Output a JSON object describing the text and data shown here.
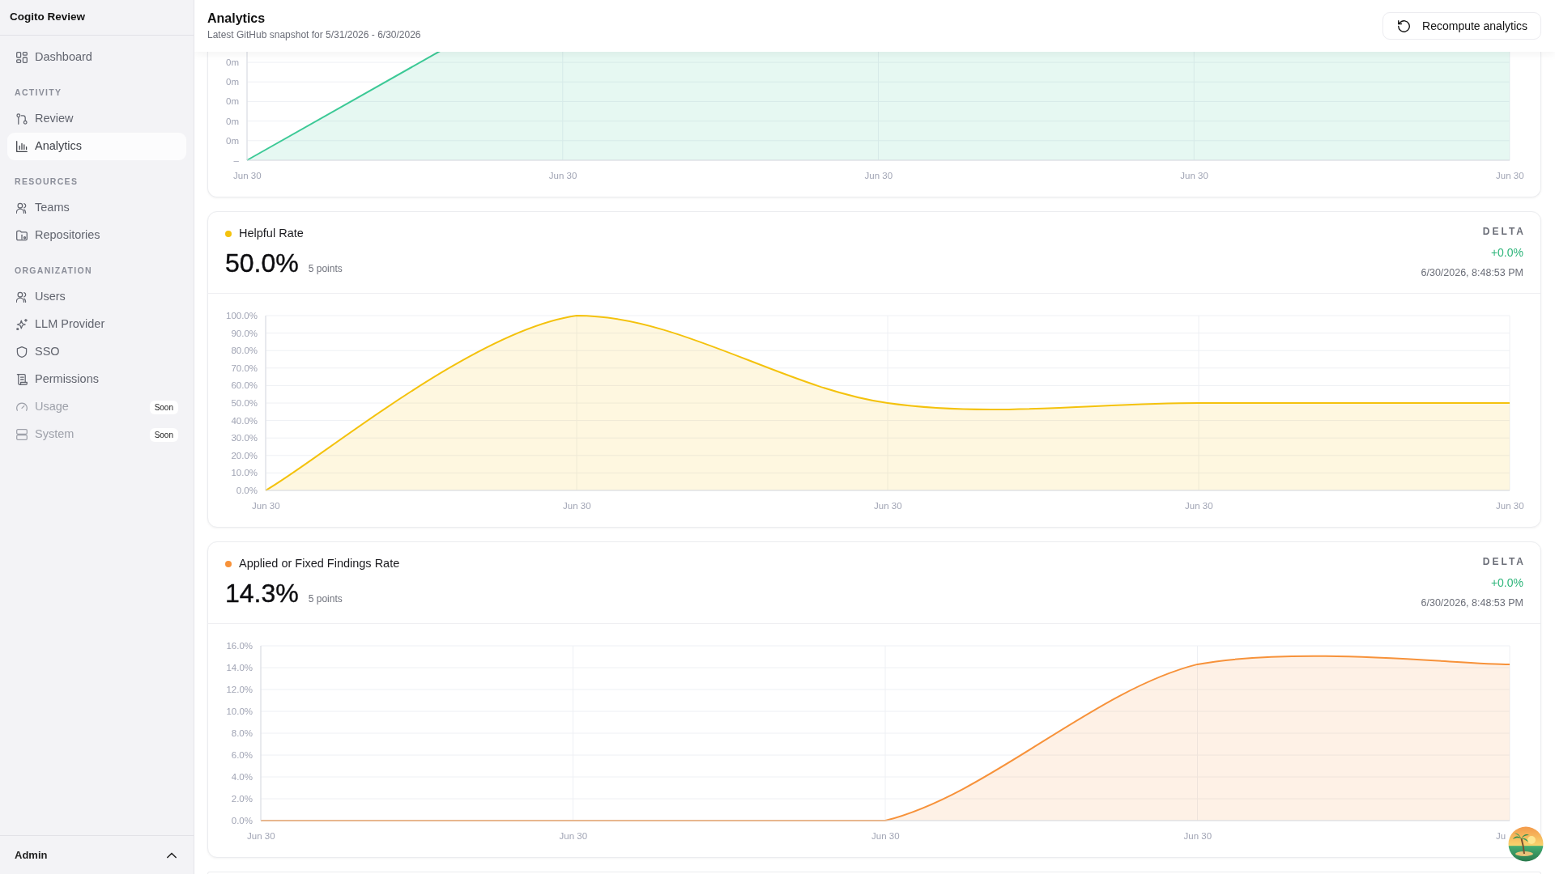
{
  "sidebar": {
    "brand": "Cogito Review",
    "sections": [
      {
        "items": [
          {
            "label": "Dashboard",
            "selected": false,
            "disabled": false
          }
        ]
      },
      {
        "heading": "ACTIVITY",
        "items": [
          {
            "label": "Review",
            "selected": false,
            "disabled": false
          },
          {
            "label": "Analytics",
            "selected": true,
            "disabled": false
          }
        ]
      },
      {
        "heading": "RESOURCES",
        "items": [
          {
            "label": "Teams",
            "selected": false,
            "disabled": false
          },
          {
            "label": "Repositories",
            "selected": false,
            "disabled": false
          }
        ]
      },
      {
        "heading": "ORGANIZATION",
        "items": [
          {
            "label": "Users",
            "selected": false,
            "disabled": false
          },
          {
            "label": "LLM Provider",
            "selected": false,
            "disabled": false
          },
          {
            "label": "SSO",
            "selected": false,
            "disabled": false
          },
          {
            "label": "Permissions",
            "selected": false,
            "disabled": false
          },
          {
            "label": "Usage",
            "selected": false,
            "disabled": true,
            "badge": "Soon"
          },
          {
            "label": "System",
            "selected": false,
            "disabled": true,
            "badge": "Soon"
          }
        ]
      }
    ],
    "footer": {
      "user": "Admin"
    }
  },
  "header": {
    "title": "Analytics",
    "subtitle": "Latest GitHub snapshot for 5/31/2026 - 6/30/2026",
    "action": "Recompute analytics"
  },
  "top_chart": {
    "y_labels": [
      "0m",
      "0m",
      "0m",
      "0m",
      "0m",
      "–"
    ],
    "x_labels": [
      "Jun 30",
      "Jun 30",
      "Jun 30",
      "Jun 30",
      "Jun 30"
    ]
  },
  "metrics": [
    {
      "title": "Helpful Rate",
      "color": "#f4c20d",
      "value": "50.0%",
      "points": "5 points",
      "delta_label": "DELTA",
      "delta": "+0.0%",
      "timestamp": "6/30/2026, 8:48:53 PM",
      "chart_data": {
        "type": "area",
        "grid": true,
        "categories": [
          "Jun 30",
          "Jun 30",
          "Jun 30",
          "Jun 30",
          "Jun 30"
        ],
        "series": [
          {
            "color": "#f4c20d",
            "values": [
              0,
              100,
              50,
              50,
              50
            ]
          }
        ],
        "ylim": [
          0,
          100
        ],
        "yticks": [
          {
            "value": 0,
            "label": "0.0%"
          },
          {
            "value": 10,
            "label": "10.0%"
          },
          {
            "value": 20,
            "label": "20.0%"
          },
          {
            "value": 30,
            "label": "30.0%"
          },
          {
            "value": 40,
            "label": "40.0%"
          },
          {
            "value": 50,
            "label": "50.0%"
          },
          {
            "value": 60,
            "label": "60.0%"
          },
          {
            "value": 70,
            "label": "70.0%"
          },
          {
            "value": 80,
            "label": "80.0%"
          },
          {
            "value": 90,
            "label": "90.0%"
          },
          {
            "value": 100,
            "label": "100.0%"
          }
        ]
      }
    },
    {
      "title": "Applied or Fixed Findings Rate",
      "color": "#f7923a",
      "value": "14.3%",
      "points": "5 points",
      "delta_label": "DELTA",
      "delta": "+0.0%",
      "timestamp": "6/30/2026, 8:48:53 PM",
      "chart_data": {
        "type": "area",
        "grid": true,
        "categories": [
          "Jun 30",
          "Jun 30",
          "Jun 30",
          "Jun 30",
          "Ju"
        ],
        "series": [
          {
            "color": "#f7923a",
            "values": [
              0,
              0,
              0,
              14.3,
              14.3
            ]
          }
        ],
        "ylim": [
          0,
          16
        ],
        "yticks": [
          {
            "value": 0,
            "label": "0.0%"
          },
          {
            "value": 2,
            "label": "2.0%"
          },
          {
            "value": 4,
            "label": "4.0%"
          },
          {
            "value": 6,
            "label": "6.0%"
          },
          {
            "value": 8,
            "label": "8.0%"
          },
          {
            "value": 10,
            "label": "10.0%"
          },
          {
            "value": 12,
            "label": "12.0%"
          },
          {
            "value": 14,
            "label": "14.0%"
          },
          {
            "value": 16,
            "label": "16.0%"
          }
        ]
      }
    }
  ]
}
